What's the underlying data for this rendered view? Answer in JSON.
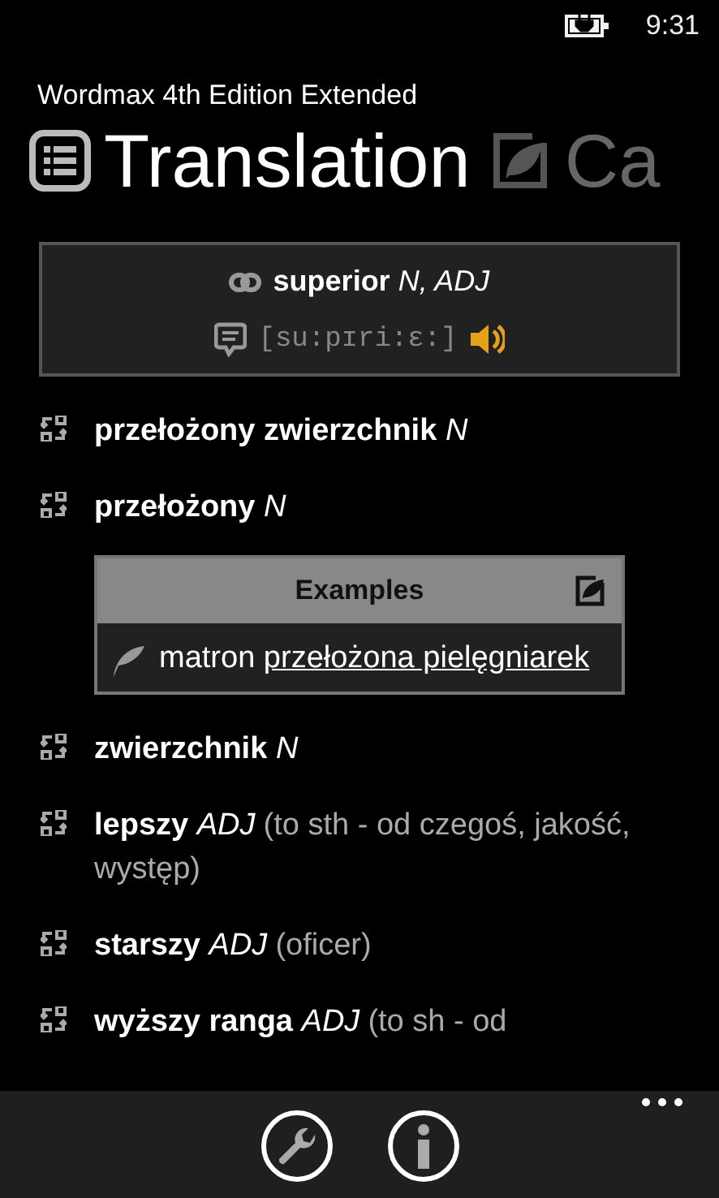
{
  "status_bar": {
    "time": "9:31"
  },
  "app_title": "Wordmax 4th Edition Extended",
  "pivot": [
    {
      "label": "Translation",
      "selected": true
    },
    {
      "label": "Ca",
      "selected": false
    }
  ],
  "headword": {
    "word": "superior",
    "pos": "N, ADJ",
    "transcription": "[su:pɪri:ɛ:]"
  },
  "entries": [
    {
      "word": "przełożony zwierzchnik",
      "pos": "N"
    },
    {
      "word": "przełożony",
      "pos": "N",
      "examples": {
        "title": "Examples",
        "items": [
          {
            "text": "matron",
            "link": "przełożona pielęgniarek"
          }
        ]
      }
    },
    {
      "word": "zwierzchnik",
      "pos": "N"
    },
    {
      "word": "lepszy",
      "pos": "ADJ",
      "note": "(to sth - od czegoś, jakość, występ)"
    },
    {
      "word": "starszy",
      "pos": "ADJ",
      "note": "(oficer)"
    },
    {
      "word": "wyższy ranga",
      "pos": "ADJ",
      "note": "(to sh - od"
    }
  ]
}
